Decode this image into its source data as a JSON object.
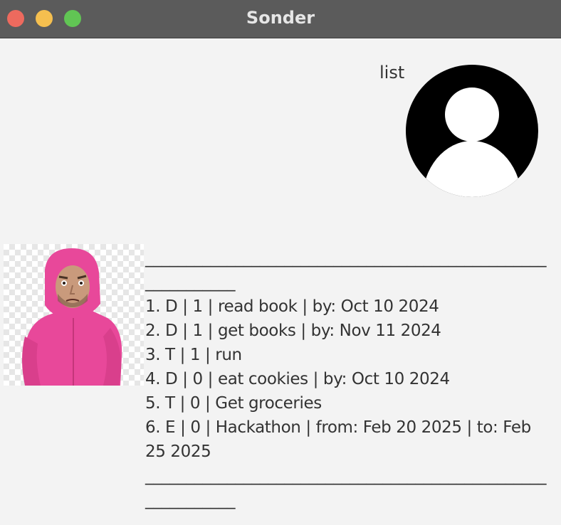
{
  "window": {
    "title": "Sonder"
  },
  "chat": {
    "user_message": "list",
    "bot_message": {
      "rule_top": "____________________________________________________________",
      "tasks": [
        "1. D | 1 | read book | by: Oct 10 2024",
        "2. D | 1 | get books | by: Nov 11 2024",
        "3. T | 1 | run",
        "4. D | 0 | eat cookies | by: Oct 10 2024",
        "5. T | 0 | Get groceries",
        "6. E | 0 | Hackathon | from: Feb 20 2025 | to: Feb 25 2025"
      ],
      "rule_bottom": "____________________________________________________________"
    }
  },
  "colors": {
    "titlebar": "#5b5b5b",
    "background": "#f3f3f3",
    "text": "#333333",
    "close": "#ed6a5e",
    "minimize": "#f5bf4f",
    "maximize": "#61c554",
    "bot_avatar_suit": "#e8489a"
  },
  "icons": {
    "user_avatar": "user-silhouette-icon",
    "bot_avatar": "bot-avatar-pink-suit"
  }
}
